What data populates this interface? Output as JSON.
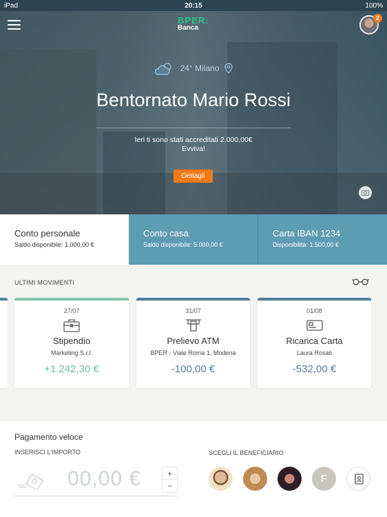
{
  "status": {
    "carrier": "iPad",
    "time": "20:15",
    "battery": "100%"
  },
  "brand": {
    "name": "BPER:",
    "sub": "Banca",
    "accent": "#25c28a"
  },
  "profile": {
    "badge": "2"
  },
  "hero": {
    "weather": "24° Milano",
    "welcome": "Bentornato Mario Rossi",
    "message_line1": "Ieri ti sono stati accreditati 2.000,00€",
    "message_line2": "Evviva!",
    "details_label": "Dettagli"
  },
  "accounts": [
    {
      "title": "Conto personale",
      "detail": "Saldo disponibile: 1.000,00 €"
    },
    {
      "title": "Conto casa",
      "detail": "Saldo disponibile: 5.000,00 €"
    },
    {
      "title": "Carta IBAN 1234",
      "detail": "Disponibilità: 1.500,00 €"
    }
  ],
  "movements": {
    "header": "ULTIMI MOVIMENTI",
    "items": [
      {
        "date": "27/07",
        "title": "Stipendio",
        "subtitle": "Marketing S.r.l.",
        "amount": "+1.242,30 €",
        "icon": "briefcase-icon",
        "color": "#7dc8aa"
      },
      {
        "date": "31/07",
        "title": "Prelievo ATM",
        "subtitle": "BPER - Viale Roma 1, Modena",
        "amount": "-100,00 €",
        "icon": "atm-icon",
        "color": "#4e7e96"
      },
      {
        "date": "01/08",
        "title": "Ricarica Carta",
        "subtitle": "Laura Rosati",
        "amount": "-532,00 €",
        "icon": "card-icon",
        "color": "#4e7e96"
      }
    ]
  },
  "quick_payment": {
    "title": "Pagamento veloce",
    "amount_label": "INSERISCI L'IMPORTO",
    "amount_value": "00,00 €",
    "plus": "+",
    "minus": "−",
    "beneficiary_label": "SCEGLI IL BENEFICIARIO",
    "beneficiaries": [
      {
        "initial": ""
      },
      {
        "initial": ""
      },
      {
        "initial": ""
      },
      {
        "initial": "F"
      }
    ]
  }
}
